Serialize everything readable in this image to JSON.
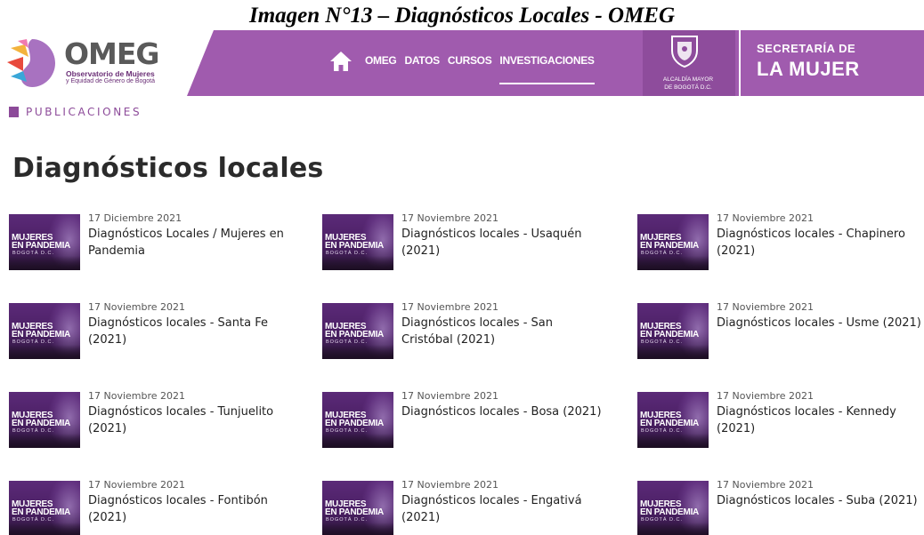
{
  "caption": "Imagen N°13 – Diagnósticos Locales - OMEG",
  "logo": {
    "name": "OMEG",
    "subtitle_line1": "Observatorio de Mujeres",
    "subtitle_line2": "y Equidad de Género de Bogotá"
  },
  "nav": {
    "items": [
      {
        "label": "OMEG",
        "active": false
      },
      {
        "label": "DATOS",
        "active": false
      },
      {
        "label": "CURSOS",
        "active": false
      },
      {
        "label": "INVESTIGACIONES",
        "active": true
      }
    ]
  },
  "alcaldia": {
    "line1": "ALCALDÍA MAYOR",
    "line2": "DE BOGOTÁ D.C."
  },
  "secretaria": {
    "line1": "SECRETARÍA DE",
    "line2": "LA MUJER"
  },
  "breadcrumb": "PUBLICACIONES",
  "page_title": "Diagnósticos locales",
  "thumbnail": {
    "line1": "MUJERES",
    "line2": "EN PANDEMIA",
    "line3": "BOGOTÁ D.C."
  },
  "colors": {
    "brand_purple": "#a05bae",
    "dark_purple": "#8c4a99"
  },
  "publications": [
    {
      "date": "17 Diciembre 2021",
      "title": "Diagnósticos Locales / Mujeres en Pandemia"
    },
    {
      "date": "17 Noviembre 2021",
      "title": "Diagnósticos locales - Usaquén (2021)"
    },
    {
      "date": "17 Noviembre 2021",
      "title": "Diagnósticos locales - Chapinero (2021)"
    },
    {
      "date": "17 Noviembre 2021",
      "title": "Diagnósticos locales - Santa Fe (2021)"
    },
    {
      "date": "17 Noviembre 2021",
      "title": "Diagnósticos locales - San Cristóbal (2021)"
    },
    {
      "date": "17 Noviembre 2021",
      "title": "Diagnósticos locales - Usme (2021)"
    },
    {
      "date": "17 Noviembre 2021",
      "title": "Diagnósticos locales - Tunjuelito (2021)"
    },
    {
      "date": "17 Noviembre 2021",
      "title": "Diagnósticos locales - Bosa (2021)"
    },
    {
      "date": "17 Noviembre 2021",
      "title": "Diagnósticos locales - Kennedy (2021)"
    },
    {
      "date": "17 Noviembre 2021",
      "title": "Diagnósticos locales - Fontibón (2021)"
    },
    {
      "date": "17 Noviembre 2021",
      "title": "Diagnósticos locales - Engativá (2021)"
    },
    {
      "date": "17 Noviembre 2021",
      "title": "Diagnósticos locales - Suba (2021)"
    }
  ]
}
